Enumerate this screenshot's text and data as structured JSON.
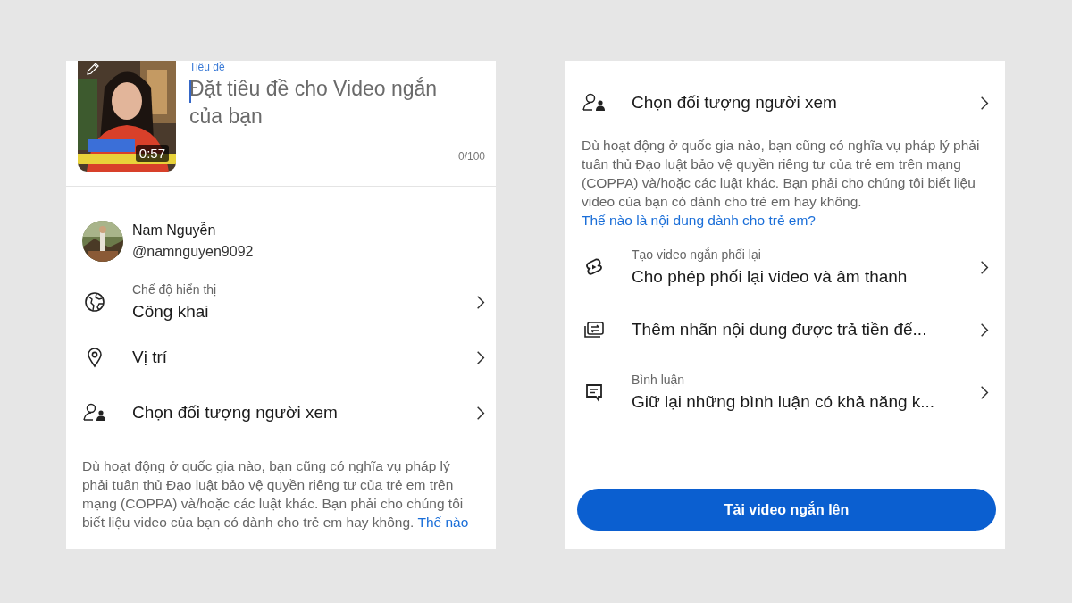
{
  "left_screen": {
    "video": {
      "duration": "0:57"
    },
    "title_field": {
      "label": "Tiêu đề",
      "placeholder": "Đặt tiêu đề cho Video ngắn của bạn",
      "counter": "0/100"
    },
    "account": {
      "name": "Nam Nguyễn",
      "handle": "@namnguyen9092"
    },
    "settings": [
      {
        "kind": "globe",
        "label": "Chế độ hiển thị",
        "value": "Công khai"
      },
      {
        "kind": "pin",
        "value": "Vị trí"
      },
      {
        "kind": "audience",
        "value": "Chọn đối tượng người xem"
      }
    ],
    "notice": {
      "text": "Dù hoạt động ở quốc gia nào, bạn cũng có nghĩa vụ pháp lý phải tuân thủ Đạo luật bảo vệ quyền riêng tư của trẻ em trên mạng (COPPA) và/hoặc các luật khác. Bạn phải cho chúng tôi biết liệu video của bạn có dành cho trẻ em hay không.",
      "link": "Thế nào"
    }
  },
  "right_screen": {
    "settings": [
      {
        "kind": "audience",
        "value": "Chọn đối tượng người xem"
      }
    ],
    "notice": {
      "text": "Dù hoạt động ở quốc gia nào, bạn cũng có nghĩa vụ pháp lý phải tuân thủ Đạo luật bảo vệ quyền riêng tư của trẻ em trên mạng (COPPA) và/hoặc các luật khác. Bạn phải cho chúng tôi biết liệu video của bạn có dành cho trẻ em hay không.",
      "link": "Thế nào là nội dung dành cho trẻ em?"
    },
    "more_settings": [
      {
        "kind": "remix",
        "label": "Tạo video ngắn phối lại",
        "value": "Cho phép phối lại video và âm thanh"
      },
      {
        "kind": "paid",
        "value": "Thêm nhãn nội dung được trả tiền để..."
      },
      {
        "kind": "comment",
        "label": "Bình luận",
        "value": "Giữ lại những bình luận có khả năng k..."
      }
    ],
    "upload_button": "Tải video ngắn lên"
  }
}
